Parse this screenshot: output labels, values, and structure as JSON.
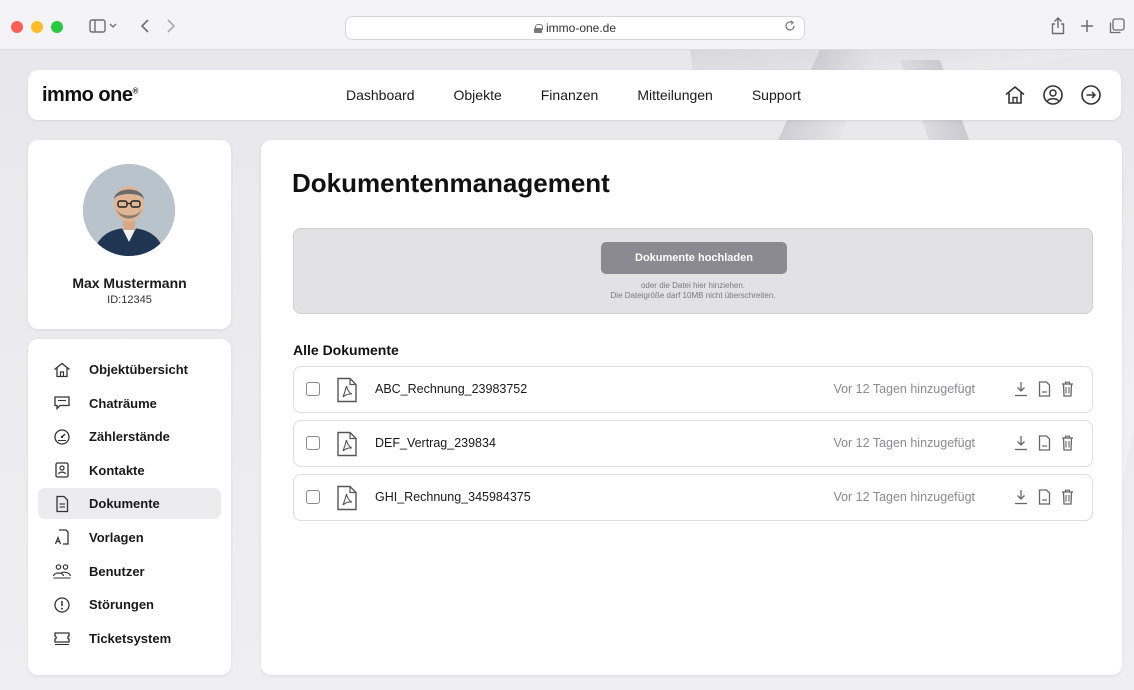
{
  "browser": {
    "url": "immo-one.de"
  },
  "header": {
    "logo": "immo one",
    "logo_mark": "®",
    "nav": [
      {
        "label": "Dashboard"
      },
      {
        "label": "Objekte"
      },
      {
        "label": "Finanzen"
      },
      {
        "label": "Mitteilungen"
      },
      {
        "label": "Support"
      }
    ],
    "icons": [
      "home-icon",
      "user-circle-icon",
      "logout-icon"
    ]
  },
  "profile": {
    "name": "Max Mustermann",
    "id": "ID:12345"
  },
  "sidebar": {
    "items": [
      {
        "label": "Objektübersicht",
        "icon": "house-icon",
        "active": false
      },
      {
        "label": "Chaträume",
        "icon": "chat-icon",
        "active": false
      },
      {
        "label": "Zählerstände",
        "icon": "gauge-icon",
        "active": false
      },
      {
        "label": "Kontakte",
        "icon": "contact-card-icon",
        "active": false
      },
      {
        "label": "Dokumente",
        "icon": "document-icon",
        "active": true
      },
      {
        "label": "Vorlagen",
        "icon": "template-icon",
        "active": false
      },
      {
        "label": "Benutzer",
        "icon": "users-icon",
        "active": false
      },
      {
        "label": "Störungen",
        "icon": "alert-icon",
        "active": false
      },
      {
        "label": "Ticketsystem",
        "icon": "ticket-icon",
        "active": false
      }
    ]
  },
  "main": {
    "title": "Dokumentenmanagement",
    "upload": {
      "button_label": "Dokumente hochladen",
      "hint_line1": "oder die Datei hier hinziehen.",
      "hint_line2": "Die Dateigröße darf 10MB nicht überschreiten."
    },
    "documents_title": "Alle Dokumente",
    "documents": [
      {
        "name": "ABC_Rechnung_23983752",
        "added": "Vor 12 Tagen hinzugefügt"
      },
      {
        "name": "DEF_Vertrag_239834",
        "added": "Vor 12 Tagen hinzugefügt"
      },
      {
        "name": "GHI_Rechnung_345984375",
        "added": "Vor 12 Tagen hinzugefügt"
      }
    ]
  },
  "colors": {
    "accent_button": "#8a8a90",
    "active_item": "#ececee",
    "muted_text": "#8a8a90"
  }
}
